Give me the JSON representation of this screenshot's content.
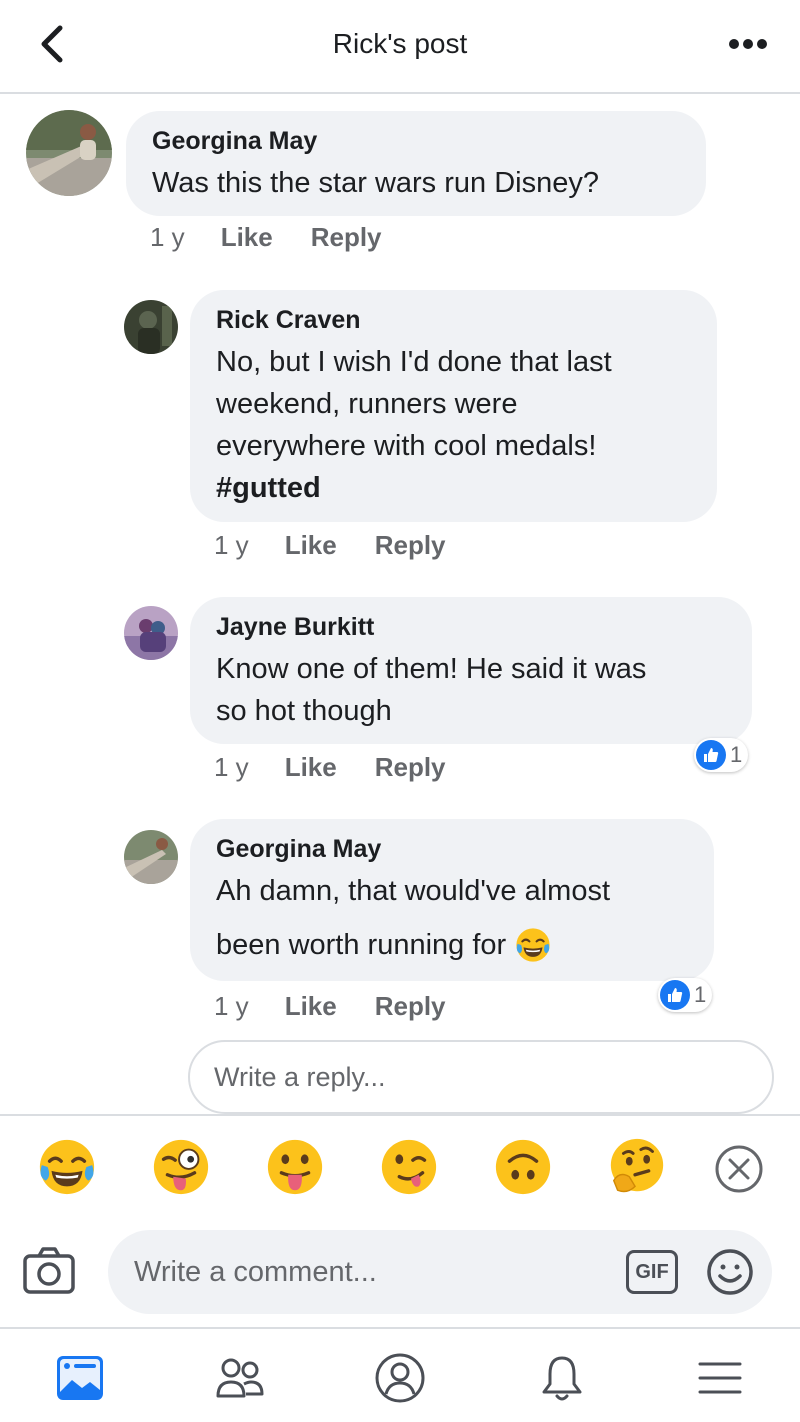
{
  "header": {
    "title": "Rick's post"
  },
  "comments": [
    {
      "author": "Georgina May",
      "lines": [
        "Was this the star wars run Disney?"
      ],
      "time": "1 y",
      "like_label": "Like",
      "reply_label": "Reply"
    },
    {
      "author": "Rick Craven",
      "lines": [
        "No, but I wish I'd done that last",
        "weekend, runners were",
        "everywhere with cool medals!",
        "#gutted"
      ],
      "time": "1 y",
      "like_label": "Like",
      "reply_label": "Reply"
    },
    {
      "author": "Jayne Burkitt",
      "lines": [
        "Know one of them! He said it was",
        "so hot though"
      ],
      "time": "1 y",
      "like_label": "Like",
      "reply_label": "Reply",
      "reaction_count": "1"
    },
    {
      "author": "Georgina May",
      "lines": [
        "Ah damn, that would've almost",
        "been worth running for"
      ],
      "time": "1 y",
      "like_label": "Like",
      "reply_label": "Reply",
      "reaction_count": "1"
    }
  ],
  "reply_input": {
    "placeholder": "Write a reply..."
  },
  "emoji_bar": {
    "items": [
      "tears-of-joy",
      "zany-face",
      "tongue-out",
      "winking-tongue",
      "upside-down-face",
      "thinking-face"
    ]
  },
  "composer": {
    "placeholder": "Write a comment...",
    "gif_label": "GIF"
  },
  "tabbar": {
    "items": [
      "news-feed-icon",
      "friends-icon",
      "profile-icon",
      "notifications-icon",
      "menu-icon"
    ]
  },
  "colors": {
    "accent": "#1877f2",
    "bubble": "#f0f2f5",
    "muted": "#65676b",
    "emoji": "#fcc21b"
  }
}
